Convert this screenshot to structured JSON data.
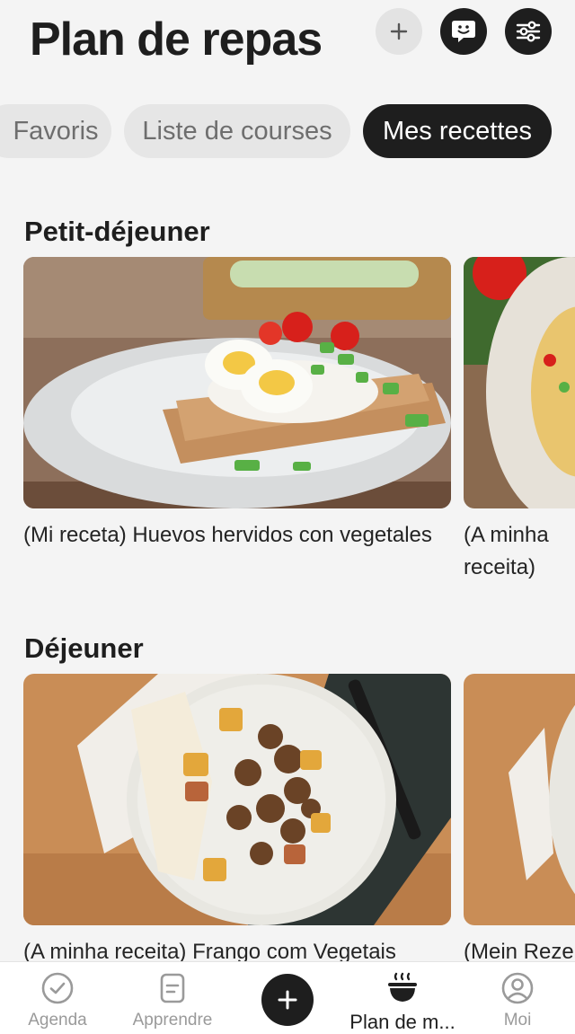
{
  "header": {
    "title": "Plan de repas",
    "add_icon": "plus-icon",
    "chat_icon": "chat-bubble-smile-icon",
    "filter_icon": "sliders-icon"
  },
  "tabs": [
    {
      "label": "Favoris",
      "active": false
    },
    {
      "label": "Liste de courses",
      "active": false
    },
    {
      "label": "Mes recettes",
      "active": true
    }
  ],
  "sections": [
    {
      "title": "Petit-déjeuner",
      "cards": [
        {
          "title": "(Mi receta) Huevos hervidos con vegetales"
        },
        {
          "title": "(A minha receita) Omelete com cogumelos"
        }
      ]
    },
    {
      "title": "Déjeuner",
      "cards": [
        {
          "title": "(A minha receita) Frango com Vegetais"
        },
        {
          "title": "(Mein Rezept)"
        }
      ]
    }
  ],
  "bottom_nav": {
    "items": [
      {
        "label": "Agenda",
        "icon": "check-circle-icon"
      },
      {
        "label": "Apprendre",
        "icon": "document-icon"
      },
      {
        "label": "Plan de m...",
        "icon": "bowl-icon",
        "active": true
      },
      {
        "label": "Moi",
        "icon": "user-circle-icon"
      }
    ],
    "center_icon": "plus-icon"
  },
  "colors": {
    "background": "#f4f4f4",
    "dark": "#1e1e1e",
    "chip": "#e6e6e6",
    "inactive": "#9a9a9a"
  }
}
